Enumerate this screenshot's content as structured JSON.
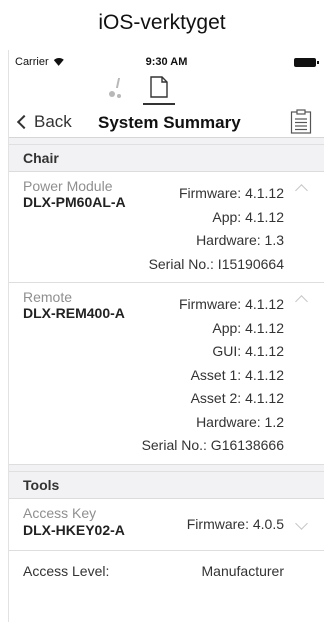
{
  "caption": "iOS-verktyget",
  "status": {
    "carrier": "Carrier",
    "time": "9:30 AM"
  },
  "nav": {
    "back_label": "Back",
    "title": "System Summary"
  },
  "sections": {
    "chair": {
      "header": "Chair",
      "power_module": {
        "name": "Power Module",
        "model": "DLX-PM60AL-A",
        "firmware": "Firmware: 4.1.12",
        "app": "App: 4.1.12",
        "hardware": "Hardware: 1.3",
        "serial": "Serial No.: I15190664"
      },
      "remote": {
        "name": "Remote",
        "model": "DLX-REM400-A",
        "firmware": "Firmware: 4.1.12",
        "app": "App: 4.1.12",
        "gui": "GUI: 4.1.12",
        "asset1": "Asset 1: 4.1.12",
        "asset2": "Asset 2: 4.1.12",
        "hardware": "Hardware: 1.2",
        "serial": "Serial No.: G16138666"
      }
    },
    "tools": {
      "header": "Tools",
      "access_key": {
        "name": "Access Key",
        "model": "DLX-HKEY02-A",
        "firmware": "Firmware: 4.0.5"
      },
      "access_level": {
        "label": "Access Level:",
        "value": "Manufacturer"
      }
    }
  },
  "icons": {
    "wheelchair_tab": "wheelchair-icon",
    "summary_tab": "document-icon",
    "report": "clipboard-icon"
  }
}
